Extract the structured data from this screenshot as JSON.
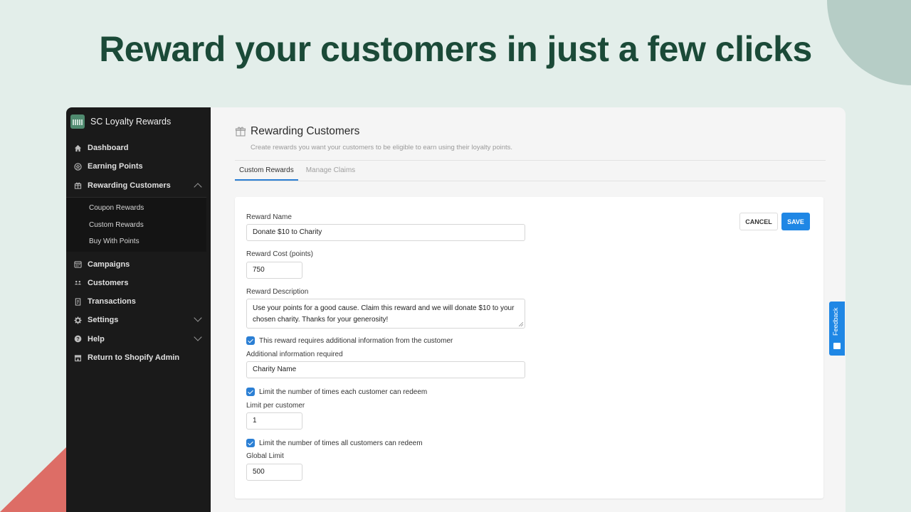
{
  "headline": "Reward your customers in just a few clicks",
  "colors": {
    "headline": "#1b4a38",
    "background": "#e3eeea",
    "sidebar": "#1a1a1a",
    "accent": "#1f87e5",
    "deco_circle": "#b6cdc6",
    "deco_triangle": "#dd6d66"
  },
  "sidebar": {
    "brand": {
      "name": "SC Loyalty Rewards",
      "icon": "calendar-logo-icon"
    },
    "items": [
      {
        "label": "Dashboard",
        "icon": "home-icon"
      },
      {
        "label": "Earning Points",
        "icon": "star-circle-icon"
      },
      {
        "label": "Rewarding Customers",
        "icon": "gift-icon",
        "expanded": true,
        "children": [
          {
            "label": "Coupon Rewards"
          },
          {
            "label": "Custom Rewards"
          },
          {
            "label": "Buy With Points"
          }
        ]
      },
      {
        "label": "Campaigns",
        "icon": "calendar-icon"
      },
      {
        "label": "Customers",
        "icon": "people-icon"
      },
      {
        "label": "Transactions",
        "icon": "receipt-icon"
      },
      {
        "label": "Settings",
        "icon": "gear-icon",
        "chevron": "down"
      },
      {
        "label": "Help",
        "icon": "help-circle-icon",
        "chevron": "down"
      },
      {
        "label": "Return to Shopify Admin",
        "icon": "store-icon"
      }
    ]
  },
  "page": {
    "title": "Rewarding Customers",
    "subtitle": "Create rewards you want your customers to be eligible to earn using their loyalty points.",
    "tabs": [
      {
        "label": "Custom Rewards",
        "active": true
      },
      {
        "label": "Manage Claims",
        "active": false
      }
    ]
  },
  "form": {
    "reward_name": {
      "label": "Reward Name",
      "value": "Donate $10 to Charity"
    },
    "reward_cost": {
      "label": "Reward Cost (points)",
      "value": "750"
    },
    "reward_description": {
      "label": "Reward Description",
      "value": "Use your points for a good cause. Claim this reward and we will donate $10 to your chosen charity. Thanks for your generosity!"
    },
    "requires_info": {
      "label": "This reward requires additional information from the customer",
      "checked": true
    },
    "additional_info": {
      "label": "Additional information required",
      "value": "Charity Name"
    },
    "limit_each": {
      "label": "Limit the number of times each customer can redeem",
      "checked": true
    },
    "limit_per_customer": {
      "label": "Limit per customer",
      "value": "1"
    },
    "limit_all": {
      "label": "Limit the number of times all customers can redeem",
      "checked": true
    },
    "global_limit": {
      "label": "Global Limit",
      "value": "500"
    },
    "cancel_label": "CANCEL",
    "save_label": "SAVE"
  },
  "feedback": {
    "label": "Feedback"
  }
}
